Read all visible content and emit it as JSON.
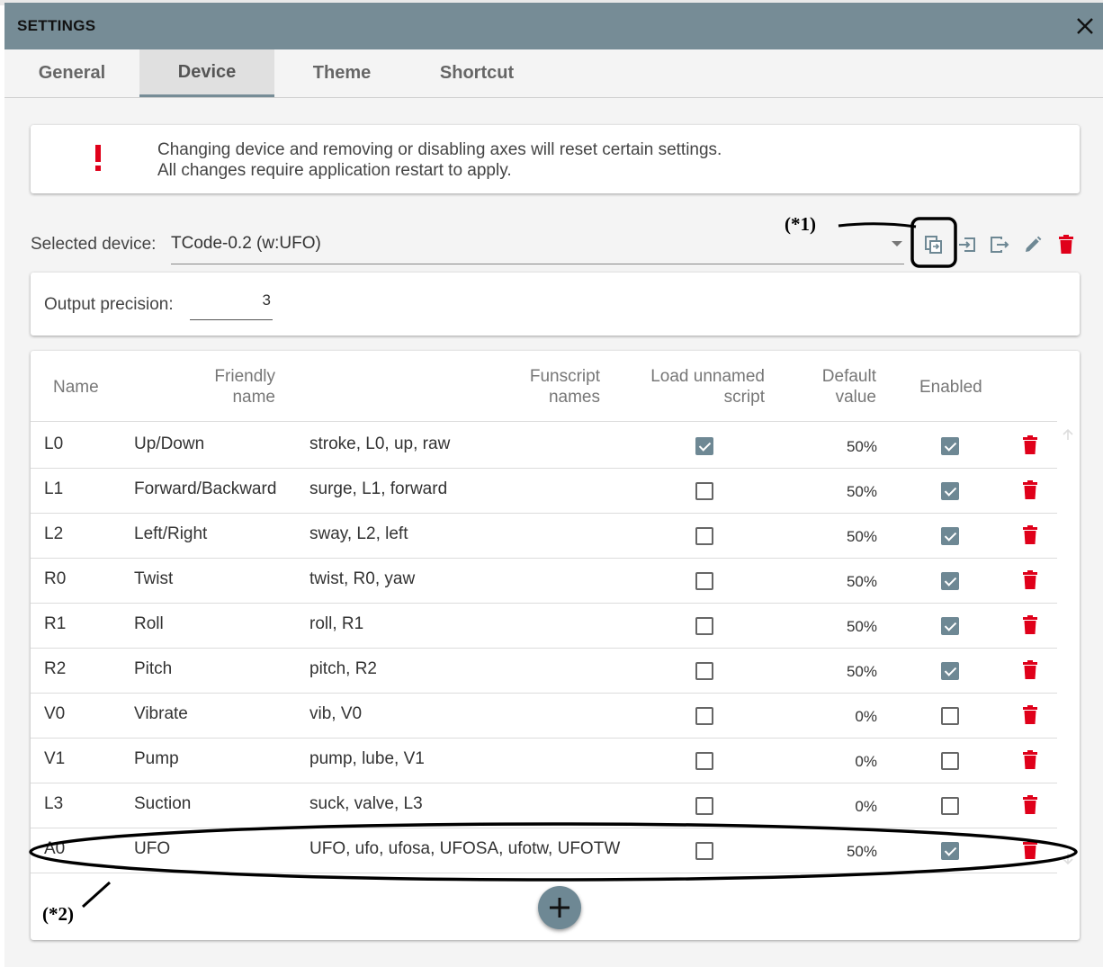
{
  "window": {
    "title": "SETTINGS"
  },
  "tabs": [
    {
      "label": "General",
      "active": false
    },
    {
      "label": "Device",
      "active": true
    },
    {
      "label": "Theme",
      "active": false
    },
    {
      "label": "Shortcut",
      "active": false
    }
  ],
  "alert": {
    "icon": "exclamation-icon",
    "line1": "Changing device and removing or disabling axes will reset certain settings.",
    "line2": "All changes require application restart to apply."
  },
  "device": {
    "label": "Selected device:",
    "value": "TCode-0.2 (w:UFO)",
    "actions": [
      "copy-icon",
      "import-icon",
      "export-icon",
      "edit-icon",
      "delete-icon"
    ]
  },
  "precision": {
    "label": "Output precision:",
    "value": "3"
  },
  "table": {
    "headers": {
      "name": "Name",
      "friendly_1": "Friendly",
      "friendly_2": "name",
      "funscript_1": "Funscript",
      "funscript_2": "names",
      "load_1": "Load unnamed",
      "load_2": "script",
      "default_1": "Default",
      "default_2": "value",
      "enabled": "Enabled"
    },
    "rows": [
      {
        "name": "L0",
        "friendly": "Up/Down",
        "funscript": "stroke, L0, up, raw",
        "load_unnamed": true,
        "default": "50%",
        "enabled": true
      },
      {
        "name": "L1",
        "friendly": "Forward/Backward",
        "funscript": "surge, L1, forward",
        "load_unnamed": false,
        "default": "50%",
        "enabled": true
      },
      {
        "name": "L2",
        "friendly": "Left/Right",
        "funscript": "sway, L2, left",
        "load_unnamed": false,
        "default": "50%",
        "enabled": true
      },
      {
        "name": "R0",
        "friendly": "Twist",
        "funscript": "twist, R0, yaw",
        "load_unnamed": false,
        "default": "50%",
        "enabled": true
      },
      {
        "name": "R1",
        "friendly": "Roll",
        "funscript": "roll, R1",
        "load_unnamed": false,
        "default": "50%",
        "enabled": true
      },
      {
        "name": "R2",
        "friendly": "Pitch",
        "funscript": "pitch, R2",
        "load_unnamed": false,
        "default": "50%",
        "enabled": true
      },
      {
        "name": "V0",
        "friendly": "Vibrate",
        "funscript": "vib, V0",
        "load_unnamed": false,
        "default": "0%",
        "enabled": false
      },
      {
        "name": "V1",
        "friendly": "Pump",
        "funscript": "pump, lube, V1",
        "load_unnamed": false,
        "default": "0%",
        "enabled": false
      },
      {
        "name": "L3",
        "friendly": "Suction",
        "funscript": "suck, valve, L3",
        "load_unnamed": false,
        "default": "0%",
        "enabled": false
      },
      {
        "name": "A0",
        "friendly": "UFO",
        "funscript": "UFO, ufo, ufosa, UFOSA, ufotw, UFOTW",
        "load_unnamed": false,
        "default": "50%",
        "enabled": true
      }
    ]
  },
  "annotations": {
    "one": "(*1)",
    "two": "(*2)"
  },
  "colors": {
    "titlebar": "#768c96",
    "accent": "#6e8894",
    "danger": "#e0001a"
  }
}
